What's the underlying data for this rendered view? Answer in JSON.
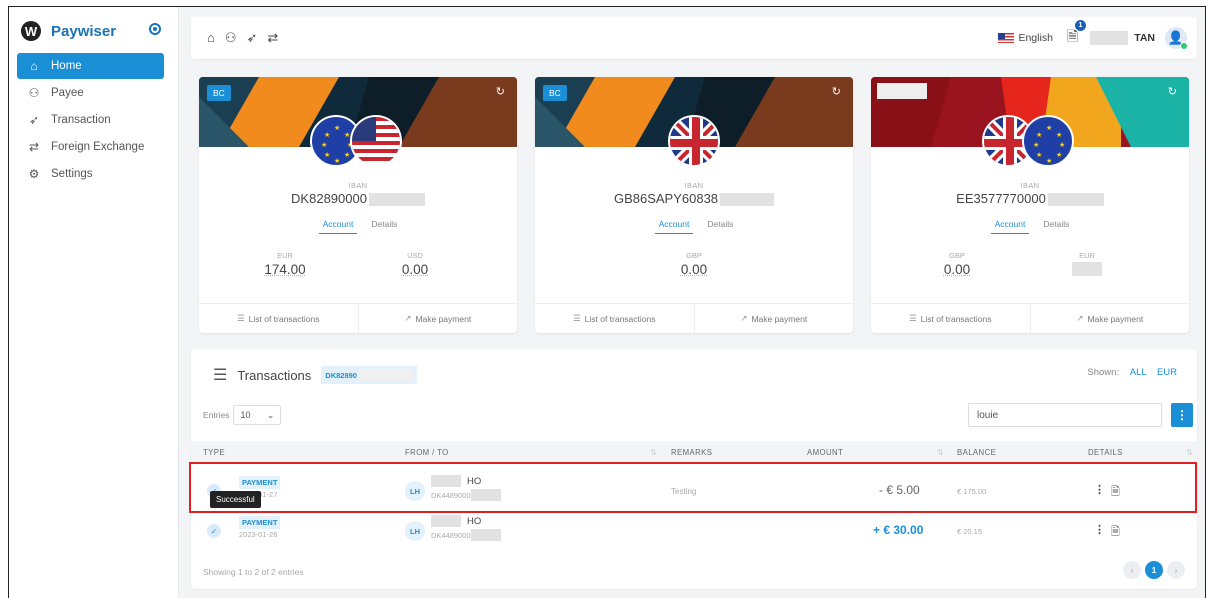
{
  "app": {
    "name": "Paywiser",
    "logo_letter": "W"
  },
  "sidebar": {
    "items": [
      {
        "label": "Home",
        "icon": "home-icon",
        "glyph": "⌂"
      },
      {
        "label": "Payee",
        "icon": "users-icon",
        "glyph": "⚇"
      },
      {
        "label": "Transaction",
        "icon": "send-icon",
        "glyph": "➶"
      },
      {
        "label": "Foreign Exchange",
        "icon": "exchange-icon",
        "glyph": "⇄"
      },
      {
        "label": "Settings",
        "icon": "gear-icon",
        "glyph": "⚙"
      }
    ]
  },
  "topbar": {
    "language": "English",
    "notification_count": "1",
    "user_name": "TAN"
  },
  "cards": [
    {
      "badge": "BC",
      "iban_label": "IBAN",
      "iban": "DK82890000",
      "tabs": [
        "Account",
        "Details"
      ],
      "balances": [
        {
          "currency": "EUR",
          "value": "174.00"
        },
        {
          "currency": "USD",
          "value": "0.00"
        }
      ],
      "footer": [
        "List of transactions",
        "Make payment"
      ]
    },
    {
      "badge": "BC",
      "iban_label": "IBAN",
      "iban": "GB86SAPY60838",
      "tabs": [
        "Account",
        "Details"
      ],
      "balances": [
        {
          "currency": "GBP",
          "value": "0.00"
        }
      ],
      "footer": [
        "List of transactions",
        "Make payment"
      ]
    },
    {
      "badge": "",
      "iban_label": "IBAN",
      "iban": "EE3577770000",
      "tabs": [
        "Account",
        "Details"
      ],
      "balances": [
        {
          "currency": "GBP",
          "value": "0.00"
        },
        {
          "currency": "EUR",
          "value": ""
        }
      ],
      "footer": [
        "List of transactions",
        "Make payment"
      ]
    }
  ],
  "transactions": {
    "title": "Transactions",
    "account_chip": "DK82890",
    "shown_label": "Shown:",
    "shown_options": [
      "ALL",
      "EUR"
    ],
    "entries_label": "Entries",
    "entries_value": "10",
    "search_value": "louie",
    "columns": [
      "TYPE",
      "FROM / TO",
      "REMARKS",
      "AMOUNT",
      "BALANCE",
      "DETAILS"
    ],
    "rows": [
      {
        "type": "PAYMENT",
        "date": "2023-01-27",
        "initials": "LH",
        "name_suffix": "HO",
        "account": "DK4489000",
        "remarks": "Testing",
        "amount": "- € 5.00",
        "balance": "€ 175.00"
      },
      {
        "type": "PAYMENT",
        "date": "2023-01-26",
        "initials": "LH",
        "name_suffix": "HO",
        "account": "DK4489000",
        "remarks": "",
        "amount": "+ € 30.00",
        "balance": "€ 20.15"
      }
    ],
    "tooltip": "Successful",
    "footer_info": "Showing 1 to 2 of 2 entries",
    "pager": {
      "prev": "‹",
      "current": "1",
      "next": "›"
    }
  }
}
